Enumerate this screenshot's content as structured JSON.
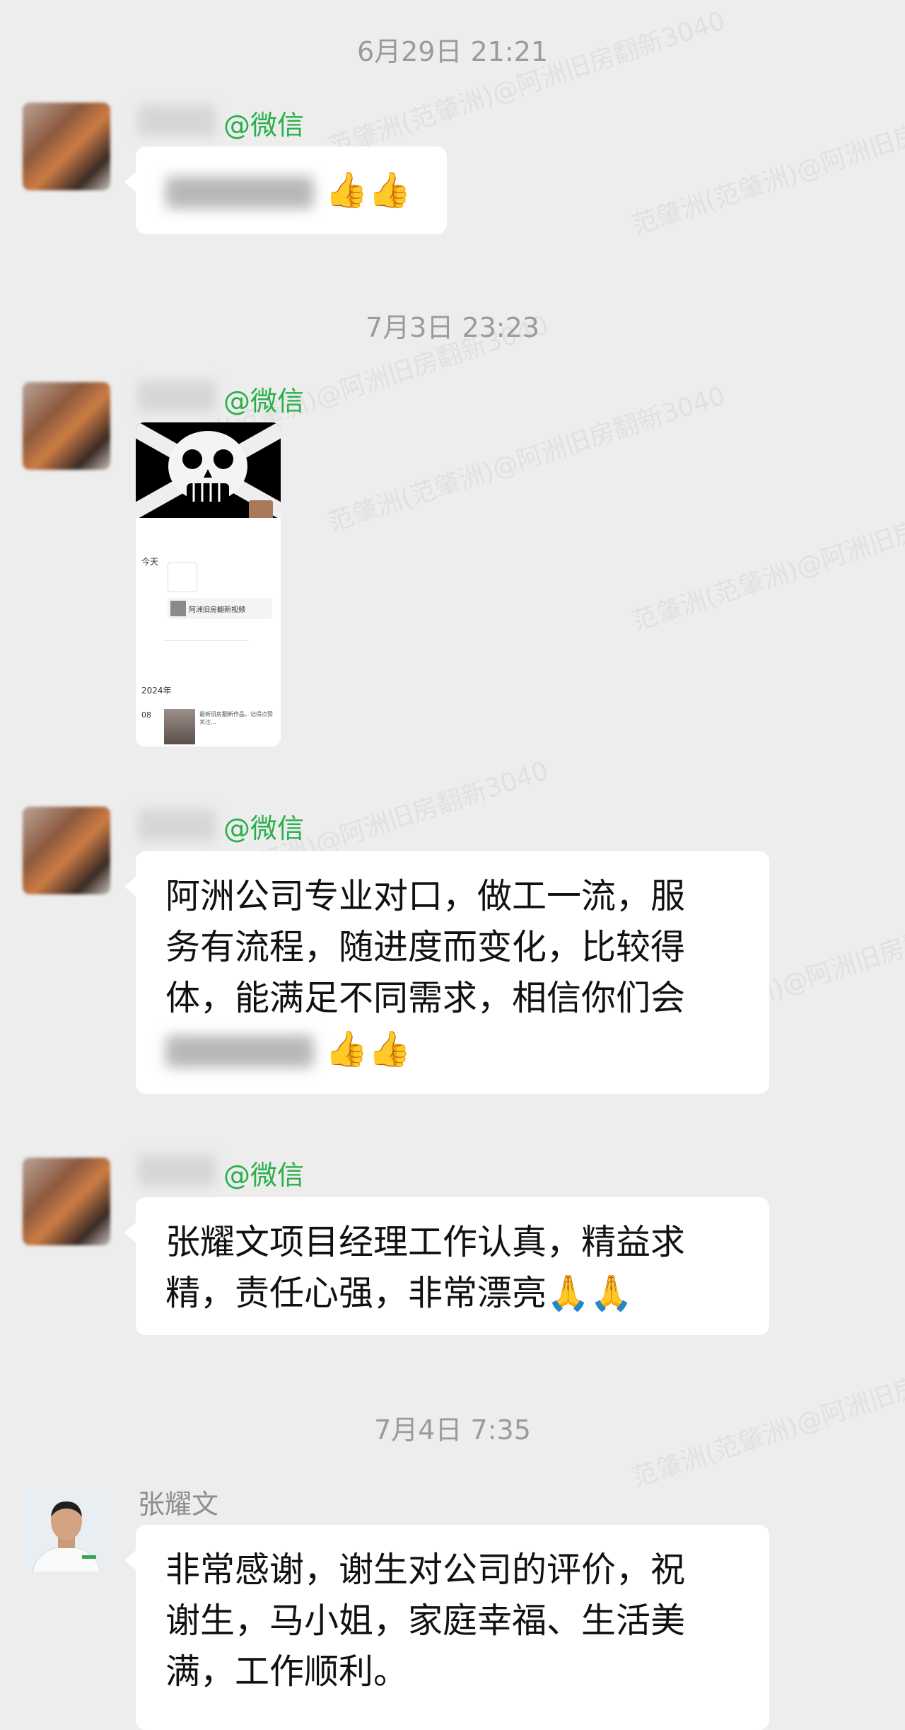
{
  "watermarks": [
    "范肇洲(范肇洲)@阿洲旧房翻新3040",
    "范肇洲(范肇洲)@阿洲旧房翻新3040",
    "范肇洲(范肇洲)@阿洲旧房翻新3040",
    "范肇洲(范肇洲)@阿洲旧房翻新3040",
    "范肇洲(范肇洲)@阿洲旧房翻新3040",
    "范肇洲(范肇洲)@阿洲旧房翻新3040",
    "范肇洲(范肇洲)@阿洲旧房翻新3040",
    "范肇洲(范肇洲)@阿洲旧房翻新3040"
  ],
  "chat": {
    "timestamps": [
      "6月29日  21:21",
      "7月3日  23:23",
      "7月4日  7:35"
    ],
    "wechat_tag": "@微信",
    "messages": [
      {
        "text_tail": "👍👍"
      },
      {
        "image_alt": "截图"
      },
      {
        "line1": "阿洲公司专业对口，做工一流，服",
        "line2": "务有流程，随进度而变化，比较得",
        "line3": "体，能满足不同需求，相信你们会",
        "line4_tail": "👍👍"
      },
      {
        "line1": "张耀文项目经理工作认真，精益求",
        "line2": "精，责任心强，非常漂亮🙏🙏"
      },
      {
        "sender": "张耀文",
        "line1": "非常感谢，谢生对公司的评价，祝",
        "line2": "谢生，马小姐，家庭幸福、生活美",
        "line3": "满，工作顺利。"
      }
    ]
  },
  "thumb": {
    "row_title": "今天",
    "link_text": "阿洲旧房翻新视频",
    "year": "2024年",
    "day": "08",
    "note": "最新旧房翻新作品，记得点赞关注..."
  }
}
